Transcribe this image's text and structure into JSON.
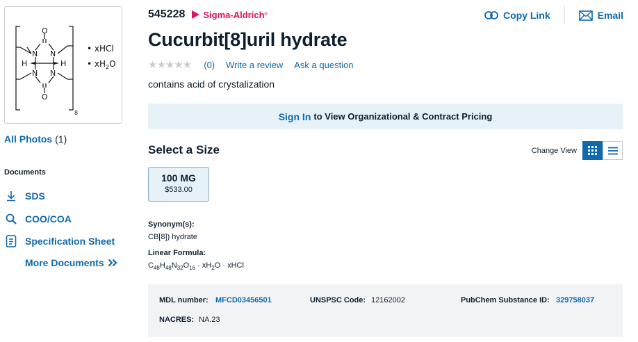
{
  "sidebar": {
    "structure": {
      "xhcl": "• xHCl",
      "xh2o_prefix": "• xH",
      "xh2o_sub": "2",
      "xh2o_suffix": "O",
      "subscript_n": "8",
      "atom_o": "O",
      "atom_n": "N",
      "atom_h": "H"
    },
    "all_photos_label": "All Photos",
    "all_photos_count": "(1)",
    "documents_heading": "Documents",
    "docs": [
      {
        "label": "SDS",
        "icon": "download-icon"
      },
      {
        "label": "COO/COA",
        "icon": "search-icon"
      },
      {
        "label": "Specification Sheet",
        "icon": "document-icon"
      }
    ],
    "more_documents": "More Documents",
    "more_icon": "double-chevron-right-icon"
  },
  "product": {
    "number": "545228",
    "brand": "Sigma-Aldrich",
    "brand_mark": "®",
    "title": "Cucurbit[8]uril hydrate",
    "stars": "★★★★★",
    "review_count": "(0)",
    "write_review": "Write a review",
    "ask_question": "Ask a question",
    "description": "contains acid of crystalization"
  },
  "actions": {
    "copy_link": "Copy Link",
    "email": "Email"
  },
  "pricing_banner": {
    "sign_in": "Sign In",
    "rest": "to View Organizational & Contract Pricing"
  },
  "size": {
    "heading": "Select a Size",
    "change_view": "Change View",
    "options": [
      {
        "size": "100 MG",
        "price": "$533.00"
      }
    ]
  },
  "properties": {
    "synonym_label": "Synonym(s):",
    "synonym_value": "CB[8]) hydrate",
    "formula_label": "Linear Formula:",
    "formula_parts": [
      "C",
      "48",
      "H",
      "48",
      "N",
      "32",
      "O",
      "16",
      " · xH",
      "2",
      "O · xHCl"
    ]
  },
  "meta": {
    "mdl_label": "MDL number:",
    "mdl_value": "MFCD03456501",
    "unspsc_label": "UNSPSC Code:",
    "unspsc_value": "12162002",
    "pubchem_label": "PubChem Substance ID:",
    "pubchem_value": "329758037",
    "nacres_label": "NACRES:",
    "nacres_value": "NA.23"
  },
  "colors": {
    "link": "#0f69af",
    "brand": "#e0115f",
    "banner_bg": "#e6f2f8",
    "meta_bg": "#f2f3f5",
    "text": "#0f1f2e"
  }
}
